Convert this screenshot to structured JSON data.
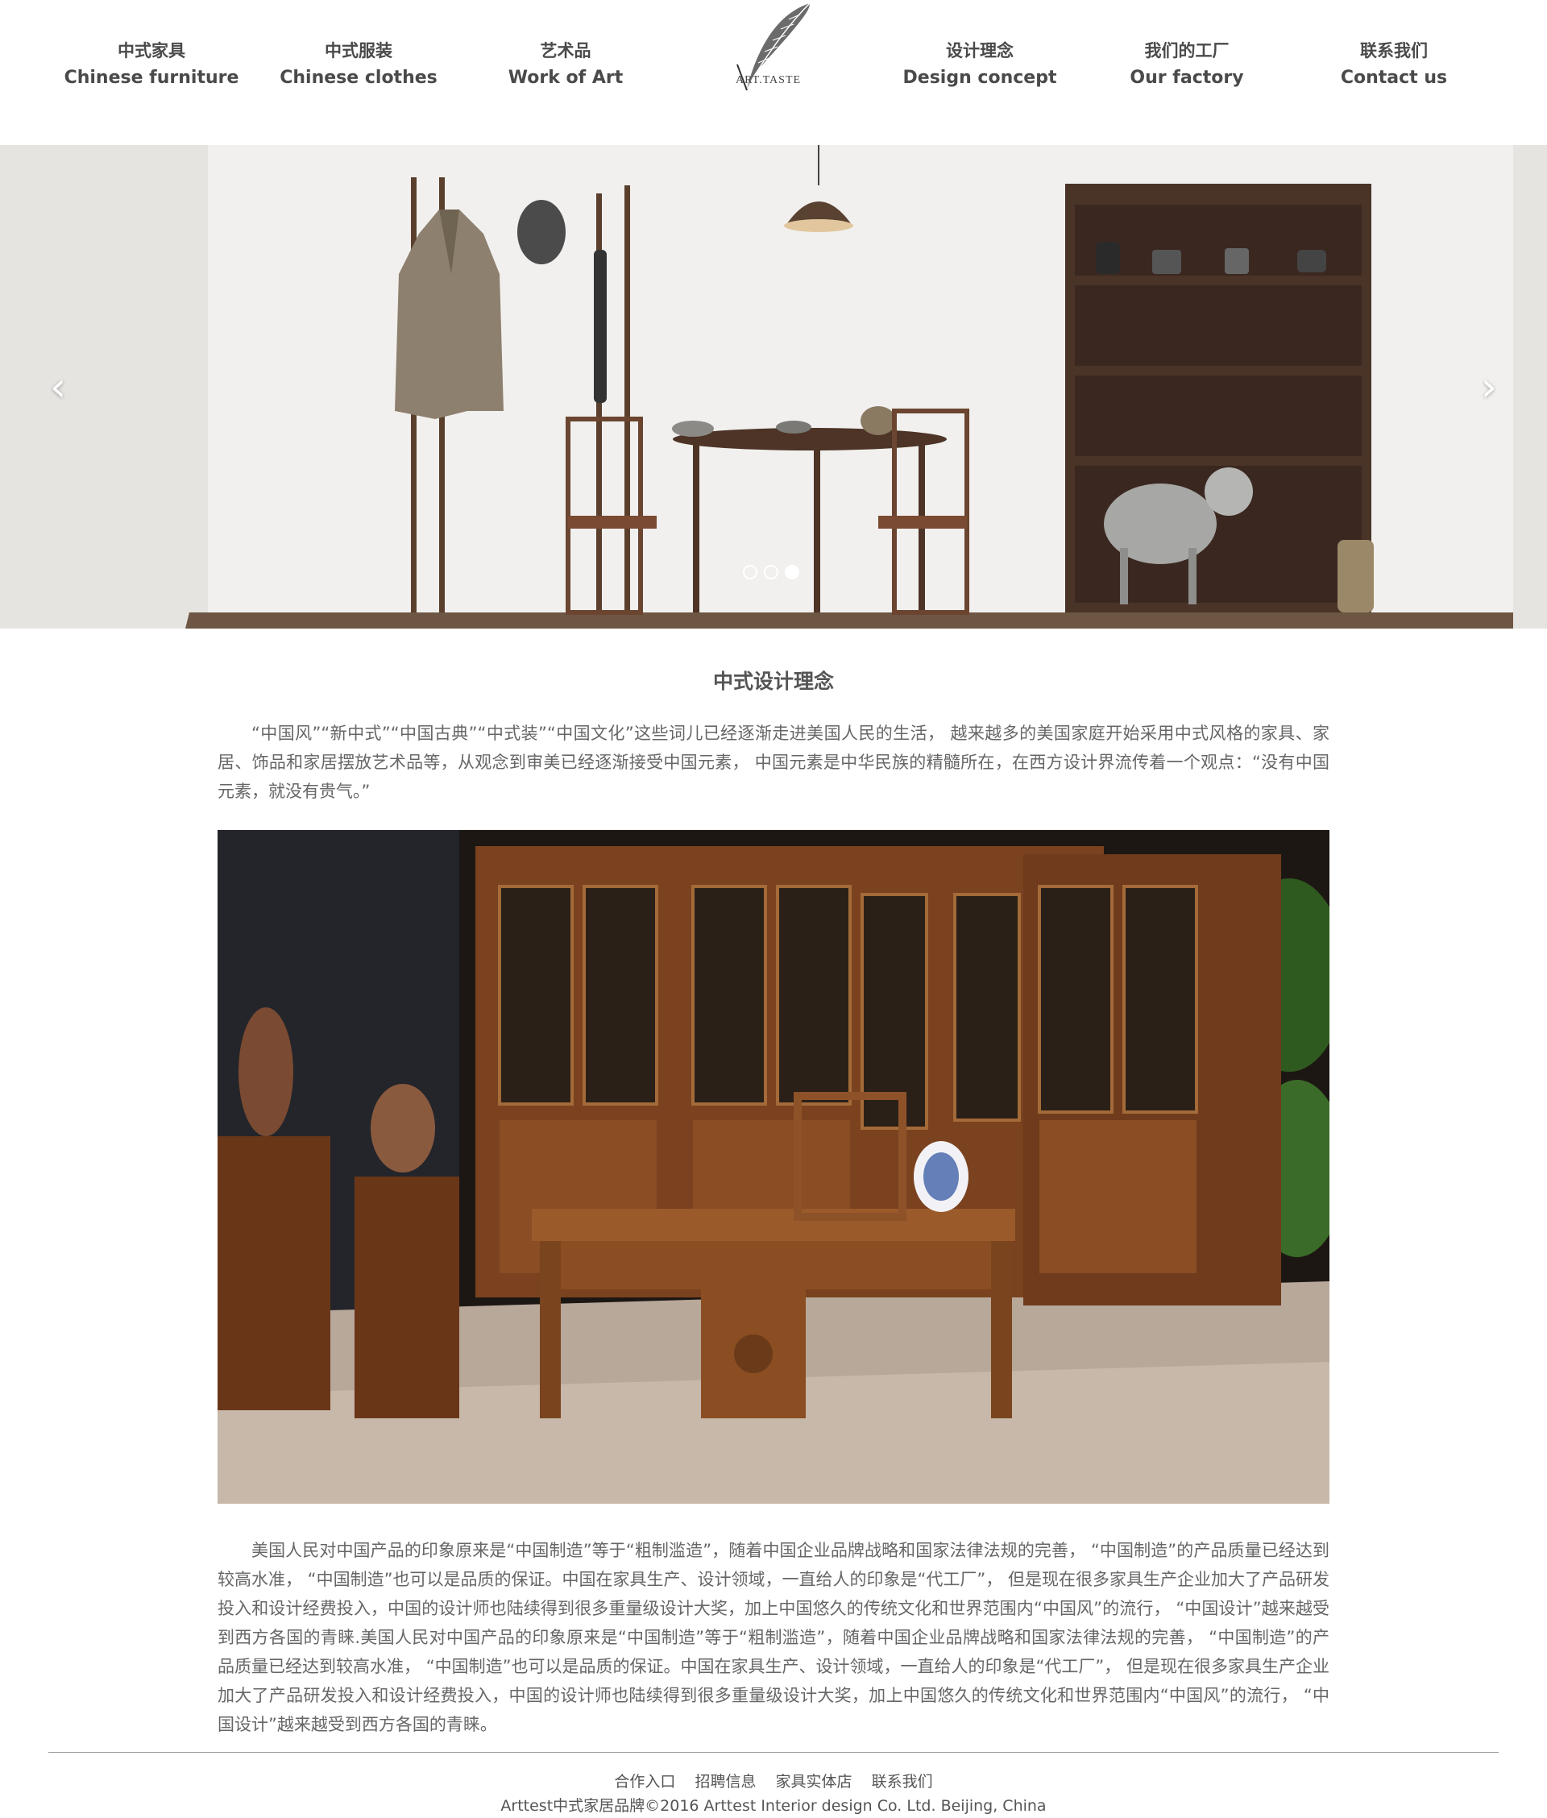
{
  "nav": {
    "items": [
      {
        "zh": "中式家具",
        "en": "Chinese furniture"
      },
      {
        "zh": "中式服装",
        "en": "Chinese clothes"
      },
      {
        "zh": "艺术品",
        "en": "Work of Art"
      },
      {
        "zh": "设计理念",
        "en": "Design concept"
      },
      {
        "zh": "我们的工厂",
        "en": "Our factory"
      },
      {
        "zh": "联系我们",
        "en": "Contact us"
      }
    ],
    "logo_text": "ART.TASTE"
  },
  "carousel": {
    "prev_icon": "chevron-left-icon",
    "next_icon": "chevron-right-icon",
    "prev_glyph": "‹",
    "next_glyph": "›",
    "slide_count": 3,
    "active_slide": 3
  },
  "section": {
    "title": "中式设计理念",
    "intro": "“中国风”“新中式”“中国古典”“中式装”“中国文化”这些词儿已经逐渐走进美国人民的生活， 越来越多的美国家庭开始采用中式风格的家具、家居、饰品和家居摆放艺术品等，从观念到审美已经逐渐接受中国元素， 中国元素是中华民族的精髓所在，在西方设计界流传着一个观点：“没有中国元素，就没有贵气。”",
    "body": "美国人民对中国产品的印象原来是“中国制造”等于“粗制滥造”，随着中国企业品牌战略和国家法律法规的完善， “中国制造”的产品质量已经达到较高水准， “中国制造”也可以是品质的保证。中国在家具生产、设计领域，一直给人的印象是“代工厂”， 但是现在很多家具生产企业加大了产品研发投入和设计经费投入，中国的设计师也陆续得到很多重量级设计大奖，加上中国悠久的传统文化和世界范围内“中国风”的流行， “中国设计”越来越受到西方各国的青睐.美国人民对中国产品的印象原来是“中国制造”等于“粗制滥造”，随着中国企业品牌战略和国家法律法规的完善， “中国制造”的产品质量已经达到较高水准， “中国制造”也可以是品质的保证。中国在家具生产、设计领域，一直给人的印象是“代工厂”， 但是现在很多家具生产企业加大了产品研发投入和设计经费投入，中国的设计师也陆续得到很多重量级设计大奖，加上中国悠久的传统文化和世界范围内“中国风”的流行， “中国设计”越来越受到西方各国的青睐。"
  },
  "footer": {
    "links": [
      "合作入口",
      "招聘信息",
      "家具实体店",
      "联系我们"
    ],
    "copyright": "Arttest中式家居品牌©2016 Arttest Interior design Co. Ltd. Beijing, China"
  },
  "colors": {
    "text": "#555555",
    "wood": "#7a4a26",
    "dark_wood": "#5a3a28",
    "wall": "#f1f0ee"
  }
}
